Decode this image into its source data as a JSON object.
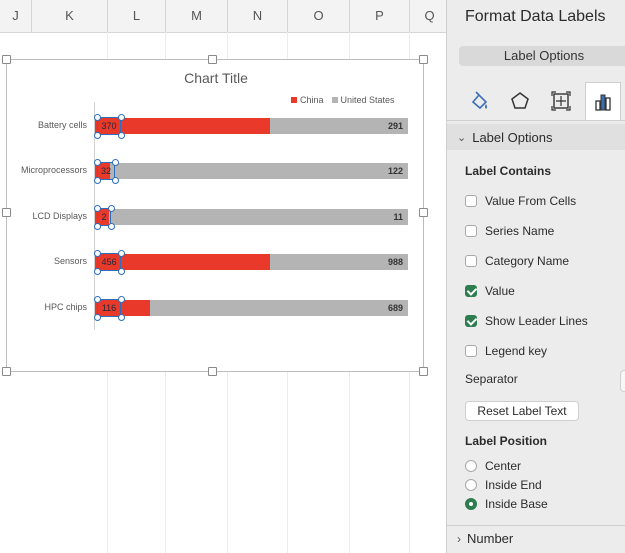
{
  "grid": {
    "columns": [
      "J",
      "K",
      "L",
      "M",
      "N",
      "O",
      "P",
      "Q"
    ]
  },
  "chart": {
    "title": "Chart Title",
    "legend": [
      {
        "name": "China",
        "color": "#e8392a"
      },
      {
        "name": "United States",
        "color": "#b4b4b4"
      }
    ],
    "selected_series": "China"
  },
  "chart_data": {
    "type": "bar",
    "orientation": "horizontal",
    "stacked": true,
    "title": "Chart Title",
    "categories": [
      "Battery cells",
      "Microprocessors",
      "LCD Displays",
      "Sensors",
      "HPC chips"
    ],
    "series": [
      {
        "name": "China",
        "values": [
          370,
          32,
          2,
          456,
          116
        ],
        "color": "#e8392a"
      },
      {
        "name": "United States",
        "values": [
          291,
          122,
          11,
          988,
          689
        ],
        "color": "#b4b4b4"
      }
    ],
    "legend_position": "top-right",
    "grid": false
  },
  "panel": {
    "title": "Format Data Labels",
    "subtab": "Label Options",
    "section_label_options": "Label Options",
    "label_contains_title": "Label Contains",
    "checks": [
      {
        "label": "Value From Cells",
        "checked": false
      },
      {
        "label": "Series Name",
        "checked": false
      },
      {
        "label": "Category Name",
        "checked": false
      },
      {
        "label": "Value",
        "checked": true
      },
      {
        "label": "Show Leader Lines",
        "checked": true
      },
      {
        "label": "Legend key",
        "checked": false
      }
    ],
    "separator_label": "Separator",
    "reset_button": "Reset Label Text",
    "label_position_title": "Label Position",
    "positions": [
      {
        "label": "Center",
        "selected": false
      },
      {
        "label": "Inside End",
        "selected": false
      },
      {
        "label": "Inside Base",
        "selected": true
      }
    ],
    "section_number": "Number",
    "tabs": [
      {
        "icon": "paint-bucket-icon",
        "active": false
      },
      {
        "icon": "pentagon-icon",
        "active": false
      },
      {
        "icon": "size-properties-icon",
        "active": false
      },
      {
        "icon": "bar-chart-icon",
        "active": true
      }
    ]
  }
}
